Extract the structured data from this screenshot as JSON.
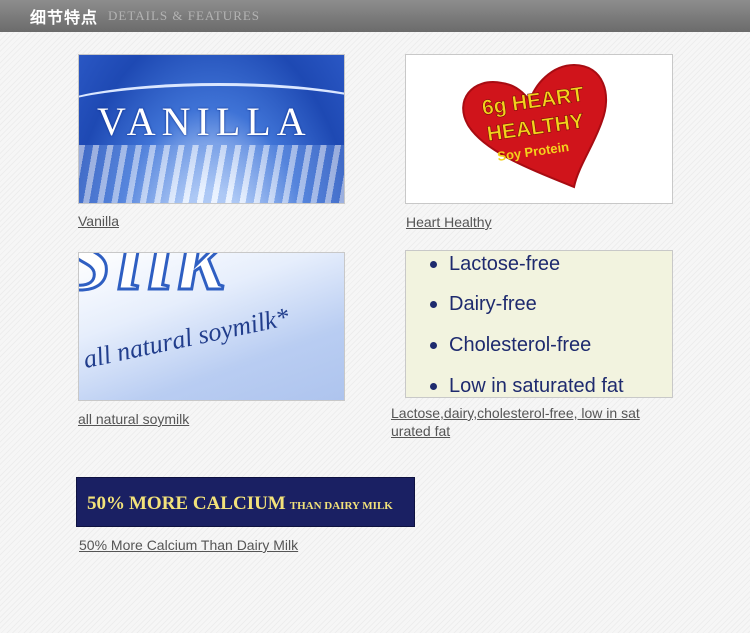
{
  "header": {
    "title_cn": "细节特点",
    "title_en": "DETAILS & FEATURES"
  },
  "tiles": [
    {
      "image_text": "VANILLA",
      "caption": "Vanilla"
    },
    {
      "image_text": [
        "6g HEART",
        "HEALTHY",
        "Soy Protein"
      ],
      "caption": "Heart Healthy"
    },
    {
      "image_text": [
        "Silk",
        "all natural soymilk*"
      ],
      "caption": "all natural soymilk"
    },
    {
      "image_text": [
        "Lactose-free",
        "Dairy-free",
        "Cholesterol-free",
        "Low in saturated fat"
      ],
      "caption_line1": "Lactose,dairy,cholesterol-free, low in sat",
      "caption_line2": "urated fat"
    },
    {
      "image_text": [
        "50%",
        "MORE CALCIUM",
        "THAN DAIRY MILK"
      ],
      "caption": "50% More Calcium Than Dairy Milk"
    }
  ],
  "colors": {
    "header_bg": "#7a7a7a",
    "vanilla_blue": "#2a57c4",
    "heart_red": "#d0141b",
    "heart_text": "#f3d21c",
    "calcium_bg": "#1a2063",
    "calcium_text": "#f2e27a"
  }
}
